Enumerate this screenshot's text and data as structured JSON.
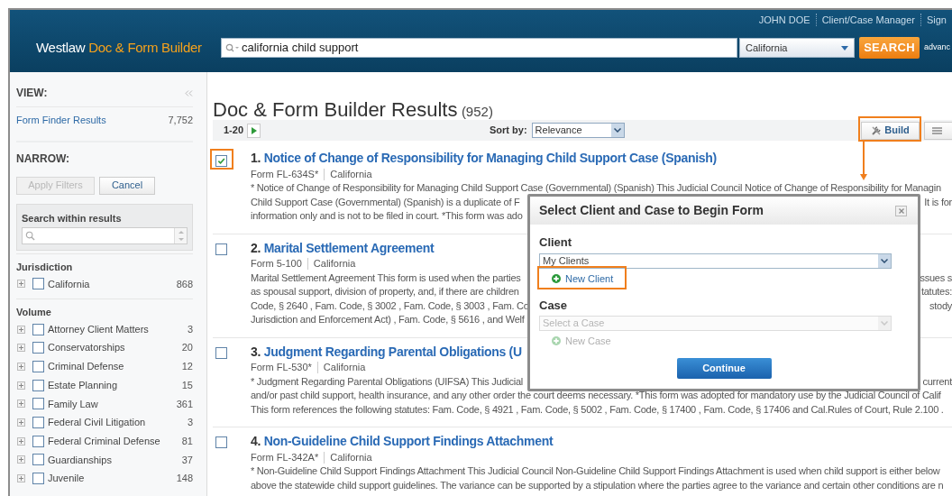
{
  "header": {
    "user": "JOHN DOE",
    "links": [
      "Client/Case Manager",
      "Sign"
    ],
    "logo": {
      "brand": "Westlaw",
      "product": "Doc & Form Builder"
    },
    "search": {
      "value": "california child support"
    },
    "jurisdiction_select": "California",
    "search_button": "SEARCH",
    "advanced_link": "advanc"
  },
  "sidebar": {
    "view_heading": "VIEW:",
    "views": [
      {
        "label": "Form Finder Results",
        "count": "7,752"
      }
    ],
    "narrow_heading": "NARROW:",
    "buttons": [
      {
        "label": "Apply Filters",
        "disabled": true
      },
      {
        "label": "Cancel",
        "disabled": false
      }
    ],
    "search_within": {
      "label": "Search within results"
    },
    "facets": [
      {
        "heading": "Jurisdiction",
        "items": [
          {
            "label": "California",
            "count": "868",
            "checked": false
          }
        ]
      },
      {
        "heading": "Volume",
        "items": [
          {
            "label": "Attorney Client Matters",
            "count": "3",
            "checked": false
          },
          {
            "label": "Conservatorships",
            "count": "20",
            "checked": false
          },
          {
            "label": "Criminal Defense",
            "count": "12",
            "checked": false
          },
          {
            "label": "Estate Planning",
            "count": "15",
            "checked": false
          },
          {
            "label": "Family Law",
            "count": "361",
            "checked": false
          },
          {
            "label": "Federal Civil Litigation",
            "count": "3",
            "checked": false
          },
          {
            "label": "Federal Criminal Defense",
            "count": "81",
            "checked": false
          },
          {
            "label": "Guardianships",
            "count": "37",
            "checked": false
          },
          {
            "label": "Juvenile",
            "count": "148",
            "checked": false
          }
        ]
      }
    ]
  },
  "results": {
    "title": "Doc & Form Builder Results",
    "count": "(952)",
    "range": "1-20",
    "sort_label": "Sort by:",
    "sort_value": "Relevance",
    "build_button": "Build",
    "items": [
      {
        "number": "1.",
        "title": "Notice of Change of Responsibility for Managing Child Support Case (Spanish)",
        "form": "Form FL-634S*",
        "jurisdiction": "California",
        "checked": true,
        "lines": [
          {
            "left": "* Notice of Change of Responsibility for Managing Child Support Case (Governmental) (Spanish) This Judicial Council Notice of Change of Responsibility for Managin"
          },
          {
            "left": "Child Support Case (Governmental) (Spanish) is a duplicate of F",
            "right": "It is for"
          },
          {
            "left": "information only and is not to be filed in court. *This form was ado"
          }
        ]
      },
      {
        "number": "2.",
        "title": "Marital Settlement Agreement",
        "form": "Form 5-100",
        "jurisdiction": "California",
        "checked": false,
        "lines": [
          {
            "left": "Marital Settlement Agreement This form is used when the parties",
            "right": "ssues s"
          },
          {
            "left": "as spousal support, division of property, and, if there are children",
            "right": "tatutes:"
          },
          {
            "left": "Code, § 2640 , Fam. Code, § 3002 , Fam. Code, § 3003 , Fam. Co",
            "right": "stody"
          },
          {
            "left": "Jurisdiction and Enforcement Act) , Fam. Code, § 5616 , and Welf"
          }
        ]
      },
      {
        "number": "3.",
        "title": "Judgment Regarding Parental Obligations (U",
        "form": "Form FL-530*",
        "jurisdiction": "California",
        "checked": false,
        "lines": [
          {
            "left": "* Judgment Regarding Parental Obligations (UIFSA) This Judicial",
            "right": "current"
          },
          {
            "left": "and/or past child support, health insurance, and any other order the court deems necessary. *This form was adopted for mandatory use by the Judicial Council of Calif"
          },
          {
            "left": "This form references the following statutes: Fam. Code, § 4921 , Fam. Code, § 5002 , Fam. Code, § 17400 , Fam. Code, § 17406 and Cal.Rules of Court, Rule 2.100 ."
          }
        ]
      },
      {
        "number": "4.",
        "title": "Non-Guideline Child Support Findings Attachment",
        "form": "Form FL-342A*",
        "jurisdiction": "California",
        "checked": false,
        "lines": [
          {
            "left": "* Non-Guideline Child Support Findings Attachment This Judicial Council Non-Guideline Child Support Findings Attachment is used when child support is either below"
          },
          {
            "left": "above the statewide child support guidelines. The variance can be supported by a stipulation where the parties agree to the variance and certain other conditions are n"
          }
        ]
      }
    ]
  },
  "dialog": {
    "title": "Select Client and Case to Begin Form",
    "client_label": "Client",
    "client_select": "My Clients",
    "new_client": {
      "label": "New Client",
      "disabled": false
    },
    "case_label": "Case",
    "case_select": {
      "placeholder": "Select a Case",
      "disabled": true
    },
    "new_case": {
      "label": "New Case",
      "disabled": true
    },
    "continue_button": "Continue"
  }
}
